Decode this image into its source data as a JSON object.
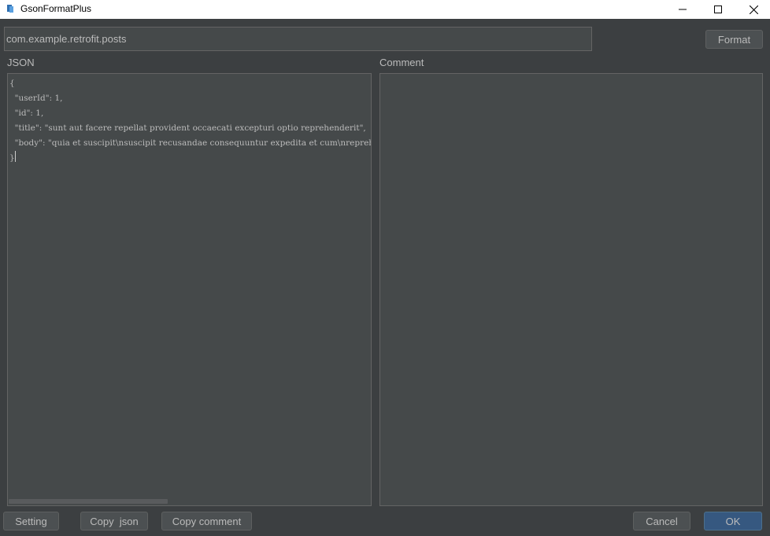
{
  "window": {
    "title": "GsonFormatPlus"
  },
  "package_field": {
    "value": "com.example.retrofit.posts"
  },
  "toolbar": {
    "format_label": "Format"
  },
  "json_panel": {
    "label": "JSON",
    "lines": [
      "{",
      "  \"userId\": 1,",
      "  \"id\": 1,",
      "  \"title\": \"sunt aut facere repellat provident occaecati excepturi optio reprehenderit\",",
      "  \"body\": \"quia et suscipit\\nsuscipit recusandae consequuntur expedita et cum\\nreprehenderit molestiae ut ut quas totam\\nnostrum rerum est autem sunt rem eveniet architecto\"",
      "}"
    ]
  },
  "comment_panel": {
    "label": "Comment",
    "value": ""
  },
  "footer": {
    "setting_label": "Setting",
    "copy_json_label": "Copy  json",
    "copy_comment_label": "Copy comment",
    "cancel_label": "Cancel",
    "ok_label": "OK"
  },
  "colors": {
    "background": "#3c3f41",
    "field_background": "#45494a",
    "text": "#bbbbbb",
    "primary_button": "#365880"
  }
}
